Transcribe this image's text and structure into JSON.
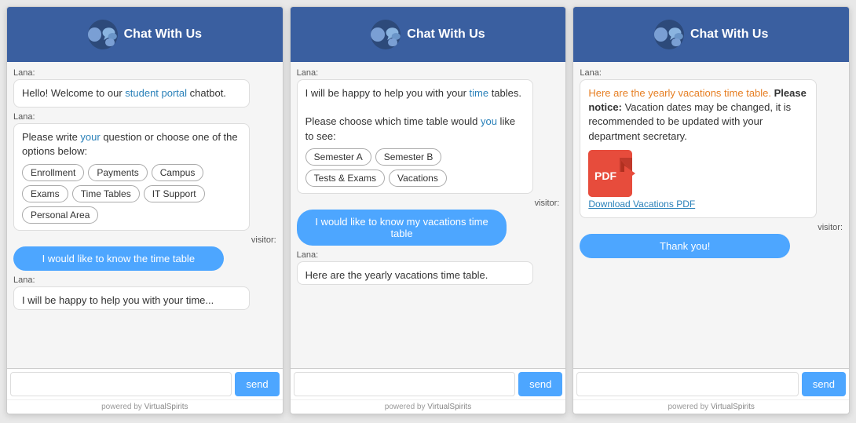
{
  "panels": [
    {
      "id": "panel1",
      "header": {
        "title": "Chat With Us"
      },
      "messages": [
        {
          "id": "m1",
          "type": "bot",
          "sender": "Lana:",
          "text": "Hello! Welcome to our student portal chatbot."
        },
        {
          "id": "m2",
          "type": "bot",
          "sender": "Lana:",
          "text": "Please write your question or choose one of the options below:",
          "options": [
            "Enrollment",
            "Payments",
            "Campus",
            "Exams",
            "Time Tables",
            "IT Support",
            "Personal Area"
          ]
        },
        {
          "id": "m3",
          "type": "visitor",
          "sender": "visitor:",
          "text": "I would like to know the time table"
        },
        {
          "id": "m4",
          "type": "bot-partial",
          "sender": "Lana:",
          "text": "I will be happy to help you with your time..."
        }
      ],
      "input_placeholder": "",
      "send_label": "send",
      "footer": "powered by VirtualSpirits"
    },
    {
      "id": "panel2",
      "header": {
        "title": "Chat With Us"
      },
      "messages": [
        {
          "id": "m1",
          "type": "bot",
          "sender": "Lana:",
          "text": "I will be happy to help you with your time tables.\n\nPlease choose which time table would you like to see:",
          "options": [
            "Semester A",
            "Semester B",
            "Tests & Exams",
            "Vacations"
          ]
        },
        {
          "id": "m2",
          "type": "visitor",
          "sender": "visitor:",
          "text": "I would like to know my vacations time table"
        },
        {
          "id": "m3",
          "type": "bot-partial",
          "sender": "Lana:",
          "text": "Here are the yearly vacations time table."
        }
      ],
      "input_placeholder": "",
      "send_label": "send",
      "footer": "powered by VirtualSpirits"
    },
    {
      "id": "panel3",
      "header": {
        "title": "Chat With Us"
      },
      "messages": [
        {
          "id": "m1",
          "type": "bot",
          "sender": "Lana:",
          "text_parts": [
            {
              "text": "Here are the yearly vacations time table. ",
              "style": "orange"
            },
            {
              "text": "Please notice:",
              "style": "bold"
            },
            {
              "text": " Vacation dates may be changed, it is recommended to be updated with your department secretary.",
              "style": "normal"
            }
          ],
          "has_pdf": true,
          "pdf_label": "Download Vacations PDF"
        },
        {
          "id": "m2",
          "type": "visitor",
          "sender": "visitor:",
          "text": "Thank you!"
        }
      ],
      "input_placeholder": "",
      "send_label": "send",
      "footer": "powered by VirtualSpirits"
    }
  ],
  "icons": {
    "chat_bubble": "💬",
    "pdf": "PDF"
  }
}
